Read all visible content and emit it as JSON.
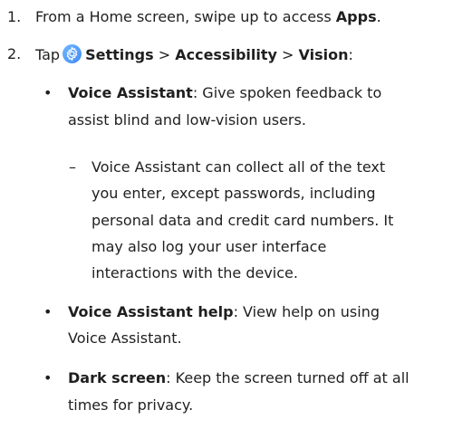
{
  "steps": [
    {
      "number": "1.",
      "text_before": "From a Home screen, swipe up to access ",
      "bold": "Apps",
      "text_after": "."
    },
    {
      "number": "2.",
      "tap": "Tap",
      "icon": "settings-gear-icon",
      "settings": "Settings",
      "sep1": ">",
      "accessibility": "Accessibility",
      "sep2": ">",
      "vision": "Vision",
      "colon": ":"
    }
  ],
  "items": [
    {
      "title": "Voice Assistant",
      "desc_line1": ": Give spoken feedback to",
      "desc_line2": "assist blind and low-vision users.",
      "sub": {
        "line1": "Voice Assistant can collect all of the text",
        "line2": "you enter, except passwords, including",
        "line3": "personal data and credit card numbers. It",
        "line4": "may also log your user interface",
        "line5": "interactions with the device."
      }
    },
    {
      "title": "Voice Assistant help",
      "desc_line1": ": View help on using",
      "desc_line2": "Voice Assistant."
    },
    {
      "title": "Dark screen",
      "desc_line1": ": Keep the screen turned off at all",
      "desc_line2": "times for privacy."
    }
  ],
  "symbols": {
    "bullet": "•",
    "dash": "–"
  }
}
